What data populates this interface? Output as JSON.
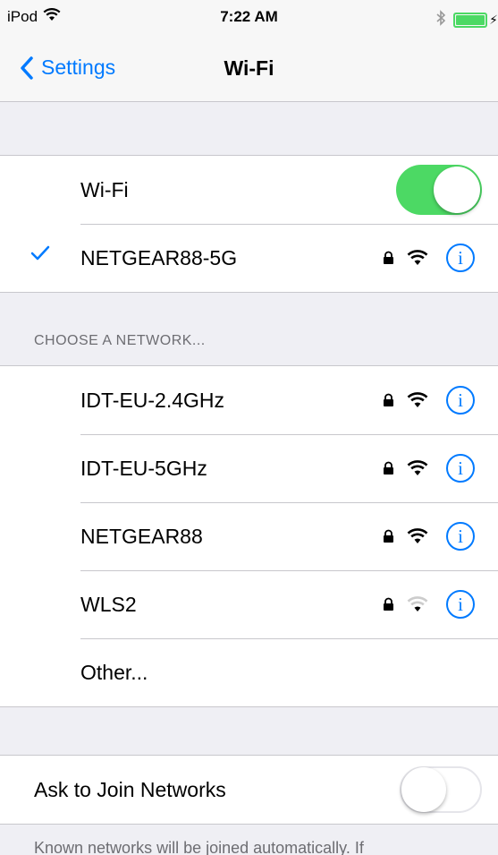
{
  "status_bar": {
    "carrier": "iPod",
    "time": "7:22 AM",
    "battery_level": 1.0
  },
  "nav": {
    "back_label": "Settings",
    "title": "Wi-Fi"
  },
  "wifi": {
    "label": "Wi-Fi",
    "enabled": true,
    "connected_network": "NETGEAR88-5G"
  },
  "choose_network": {
    "header": "CHOOSE A NETWORK...",
    "networks": [
      {
        "name": "IDT-EU-2.4GHz",
        "secured": true
      },
      {
        "name": "IDT-EU-5GHz",
        "secured": true
      },
      {
        "name": "NETGEAR88",
        "secured": true
      },
      {
        "name": "WLS2",
        "secured": true
      }
    ],
    "other_label": "Other..."
  },
  "ask_to_join": {
    "label": "Ask to Join Networks",
    "enabled": false,
    "footer": "Known networks will be joined automatically. If"
  },
  "colors": {
    "accent": "#007aff",
    "toggle_on": "#4cd964",
    "background": "#efeff4",
    "separator": "#c8c7cc"
  },
  "icons": {
    "wifi": "wifi-icon",
    "lock": "lock-icon",
    "info": "info-icon",
    "check": "checkmark-icon",
    "back": "chevron-left-icon",
    "bluetooth": "bluetooth-icon",
    "battery": "battery-icon"
  }
}
